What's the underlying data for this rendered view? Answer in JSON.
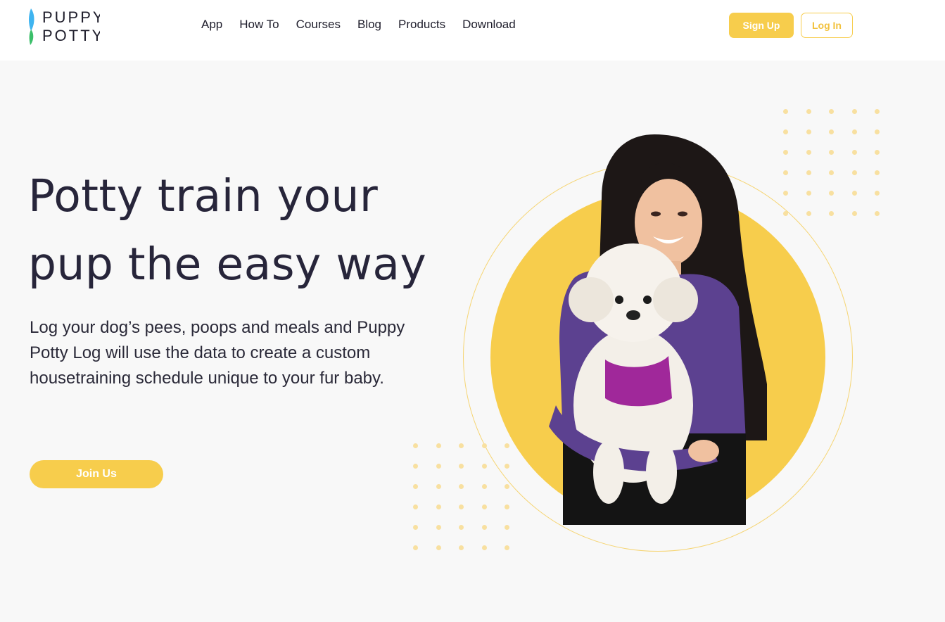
{
  "brand": {
    "line1": "PUPPY",
    "line2": "POTTY"
  },
  "nav": {
    "items": [
      "App",
      "How To",
      "Courses",
      "Blog",
      "Products",
      "Download"
    ]
  },
  "header": {
    "signup_label": "Sign Up",
    "login_label": "Log In"
  },
  "hero": {
    "headline": "Potty train your pup the easy way",
    "description": "Log your dog’s pees, poops and meals and Puppy Potty Log will use the data to create a custom housetraining schedule unique to your fur baby.",
    "cta_label": "Join Us"
  },
  "colors": {
    "accent": "#f7cd4c",
    "text": "#27253a",
    "background": "#f8f8f8"
  }
}
